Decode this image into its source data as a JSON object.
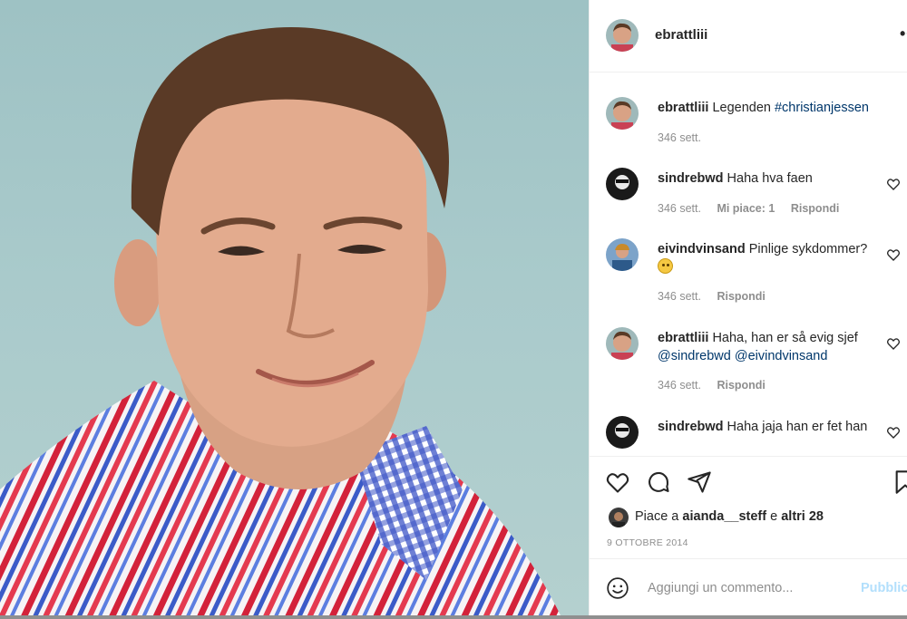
{
  "post": {
    "image_alt": "portrait",
    "author": "ebrattliii",
    "more_label": "•••"
  },
  "caption": {
    "username": "ebrattliii",
    "text": "Legenden",
    "hashtag": "#christianjessen",
    "time": "346 sett."
  },
  "comments": [
    {
      "username": "sindrebwd",
      "text": "Haha hva faen",
      "time": "346 sett.",
      "likes": "Mi piace: 1",
      "reply": "Rispondi"
    },
    {
      "username": "eivindvinsand",
      "text": "Pinlige sykdommer?",
      "time": "346 sett.",
      "reply": "Rispondi"
    },
    {
      "username": "ebrattliii",
      "text": "Haha, han er så evig sjef",
      "mention1": "@sindrebwd",
      "mention2": "@eivindvinsand",
      "time": "346 sett.",
      "reply": "Rispondi"
    },
    {
      "username": "sindrebwd",
      "text": "Haha jaja han er fet han"
    }
  ],
  "likes": {
    "prefix": "Piace a",
    "user": "aianda__steff",
    "connector": "e",
    "others": "altri 28"
  },
  "date": "9 OTTOBRE 2014",
  "add_comment": {
    "placeholder": "Aggiungi un commento...",
    "publish": "Pubblica"
  },
  "icons": [
    "heart-icon",
    "comment-icon",
    "share-icon",
    "bookmark-icon",
    "smile-icon",
    "more-icon"
  ],
  "colors": {
    "link": "#00376b",
    "muted": "#8e8e8e",
    "publish": "#b2dffc",
    "border": "#efefef"
  }
}
